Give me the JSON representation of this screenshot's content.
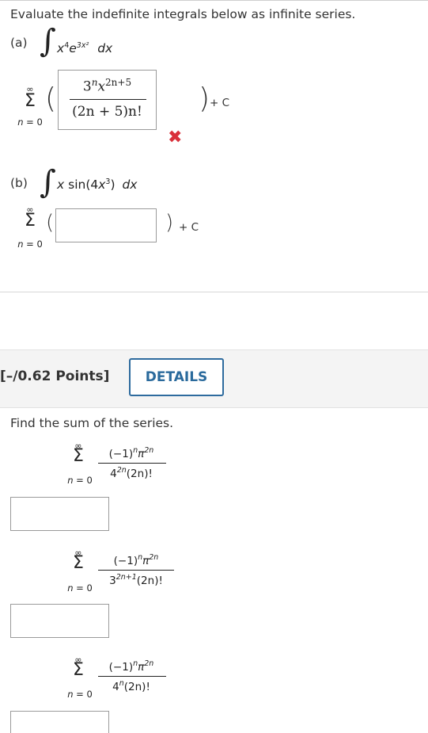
{
  "question": {
    "intro": "Evaluate the indefinite integrals below as infinite series."
  },
  "part_a": {
    "label": "(a)",
    "integral_sign": "∫",
    "integrand_base": "x",
    "integrand_base_exp": "4",
    "integrand_e": "e",
    "integrand_e_exp": "3x²",
    "differential": "dx",
    "sum_upper": "∞",
    "sum_symbol": "Σ",
    "sum_lower_var": "n",
    "sum_lower_rest": " = 0",
    "answer_numerator": "3ⁿxⁿ²ⁿ⁺⁵",
    "answer_num_base": "3",
    "answer_num_exp1": "n",
    "answer_num_x": "x",
    "answer_num_exp2": "2n+5",
    "answer_denominator": "(2n + 5)n!",
    "plus_c": "+ C",
    "status_icon": "cross-icon",
    "status_color": "#d9303a"
  },
  "part_b": {
    "label": "(b)",
    "integral_sign": "∫",
    "integrand": "x sin(4x³) dx",
    "integrand_x": "x",
    "integrand_sin": " sin(4",
    "integrand_x2": "x",
    "integrand_exp": "3",
    "integrand_close": ")",
    "differential": "dx",
    "sum_upper": "∞",
    "sum_symbol": "Σ",
    "sum_lower_var": "n",
    "sum_lower_rest": " = 0",
    "answer_value": "",
    "plus_c": "+ C"
  },
  "question2": {
    "points": "[–/0.62 Points]",
    "details_button": "DETAILS",
    "prompt": "Find the sum of the series.",
    "series": [
      {
        "upper": "∞",
        "symbol": "Σ",
        "lower_var": "n",
        "lower_rest": " = 0",
        "numerator": "(−1)ⁿπ²ⁿ",
        "num_a": "(−1)",
        "num_a_exp": "n",
        "num_b": "π",
        "num_b_exp": "2n",
        "denominator": "4²ⁿ(2n)!",
        "den_a": "4",
        "den_a_exp": "2n",
        "den_b": "(2n)!",
        "answer_value": ""
      },
      {
        "upper": "∞",
        "symbol": "Σ",
        "lower_var": "n",
        "lower_rest": " = 0",
        "numerator": "(−1)ⁿπ²ⁿ",
        "num_a": "(−1)",
        "num_a_exp": "n",
        "num_b": "π",
        "num_b_exp": "2n",
        "denominator": "3²ⁿ⁺¹(2n)!",
        "den_a": "3",
        "den_a_exp": "2n+1",
        "den_b": "(2n)!",
        "answer_value": ""
      },
      {
        "upper": "∞",
        "symbol": "Σ",
        "lower_var": "n",
        "lower_rest": " = 0",
        "numerator": "(−1)ⁿπ²ⁿ",
        "num_a": "(−1)",
        "num_a_exp": "n",
        "num_b": "π",
        "num_b_exp": "2n",
        "denominator": "4ⁿ(2n)!",
        "den_a": "4",
        "den_a_exp": "n",
        "den_b": "(2n)!",
        "answer_value": ""
      }
    ]
  }
}
